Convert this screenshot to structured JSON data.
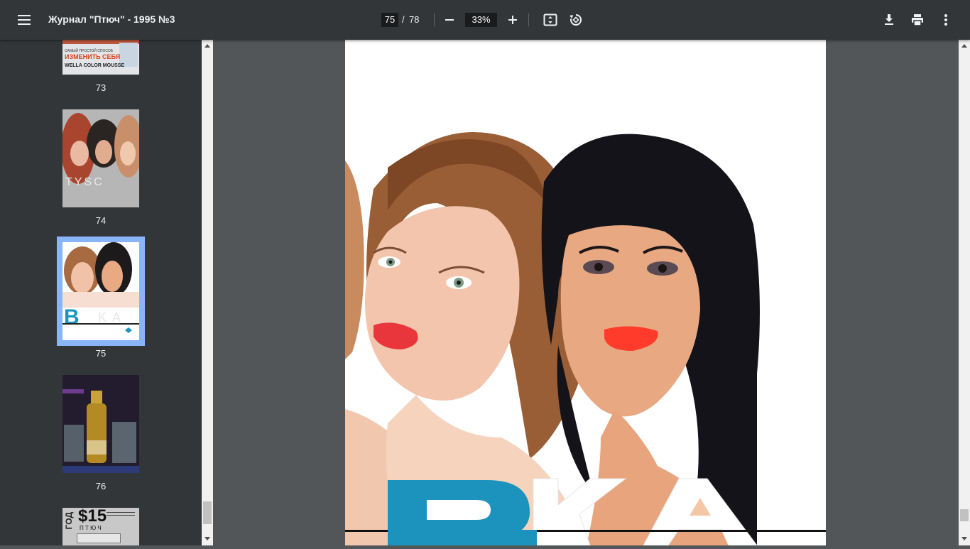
{
  "toolbar": {
    "title": "Журнал \"Птюч\" - 1995 №3",
    "current_page": "75",
    "separator": "/",
    "total_pages": "78",
    "zoom": "33%",
    "icons": [
      "menu-icon",
      "zoom-out-icon",
      "zoom-in-icon",
      "fit-to-page-icon",
      "rotate-icon",
      "download-icon",
      "print-icon",
      "more-vert-icon"
    ]
  },
  "sidebar": {
    "thumbnails": [
      {
        "number": "73",
        "caption_line1": "САМЫЙ ПРОСТОЙ СПОСОБ",
        "caption_line2": "ИЗМЕНИТЬ СЕБЯ",
        "caption_line3": "WELLA COLOR MOUSSE"
      },
      {
        "number": "74",
        "caption": "TYSC"
      },
      {
        "number": "75",
        "selected": true
      },
      {
        "number": "76"
      },
      {
        "number": "",
        "caption_main": "$15",
        "caption_side": "ГОД",
        "caption_sub": "П Т Ю Ч"
      }
    ]
  },
  "colors": {
    "toolbar": "#323639",
    "viewer_bg": "#525659",
    "selection": "#8ab4f8",
    "brand_teal": "#1b93bd"
  }
}
